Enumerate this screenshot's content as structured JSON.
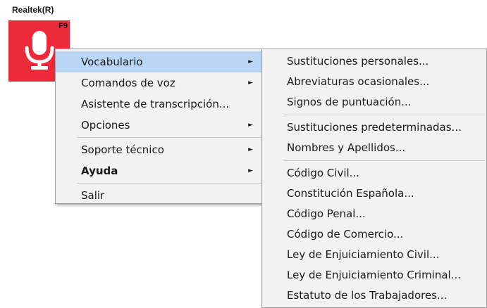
{
  "device": {
    "label": "Realtek(R)",
    "hotkey": "F9",
    "icon": "microphone-icon"
  },
  "colors": {
    "tile": "#ec2a3a",
    "highlight": "#b9d7f4",
    "menu_bg": "#f2f2f2"
  },
  "main_menu": {
    "vocabulario": "Vocabulario",
    "comandos": "Comandos de voz",
    "asistente": "Asistente de transcripción...",
    "opciones": "Opciones",
    "soporte": "Soporte técnico",
    "ayuda": "Ayuda",
    "salir": "Salir",
    "submenu_arrow": "►"
  },
  "sub_menu": {
    "items": [
      "Sustituciones personales...",
      "Abreviaturas ocasionales...",
      "Signos de puntuación...",
      "Sustituciones predeterminadas...",
      "Nombres y Apellidos...",
      "Código Civil...",
      "Constitución Española...",
      "Código Penal...",
      "Código de Comercio...",
      "Ley de Enjuiciamiento Civil...",
      "Ley de Enjuiciamiento Criminal...",
      "Estatuto de los Trabajadores..."
    ]
  }
}
